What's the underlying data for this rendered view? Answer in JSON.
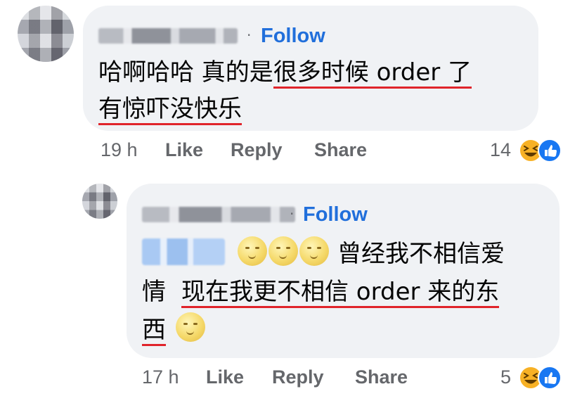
{
  "comment1": {
    "follow_label": "Follow",
    "separator": "·",
    "text_line1_plain": "哈啊哈哈 真的是",
    "text_line1_underlined": "很多时候 order 了",
    "text_line2_underlined": "有惊吓没快乐",
    "time": "19 h",
    "like_label": "Like",
    "reply_label": "Reply",
    "share_label": "Share",
    "reaction_count": "14",
    "reactions": [
      "laugh-icon",
      "like-icon"
    ]
  },
  "comment2": {
    "follow_label": "Follow",
    "separator": "·",
    "text_line1_after_emoji": "曾经我不相信爱",
    "text_line2_plain": "情",
    "text_line2_underlined": "现在我更不相信 order 来的东",
    "text_line3_underlined": "西",
    "time": "17 h",
    "like_label": "Like",
    "reply_label": "Reply",
    "share_label": "Share",
    "reaction_count": "5",
    "reactions": [
      "laugh-icon",
      "like-icon"
    ]
  },
  "colors": {
    "bubble": "#f0f2f5",
    "follow": "#216fdb",
    "meta": "#65676b",
    "underline": "#e0242b",
    "like_blue": "#1877f2",
    "laugh_yellow": "#f7b125"
  }
}
